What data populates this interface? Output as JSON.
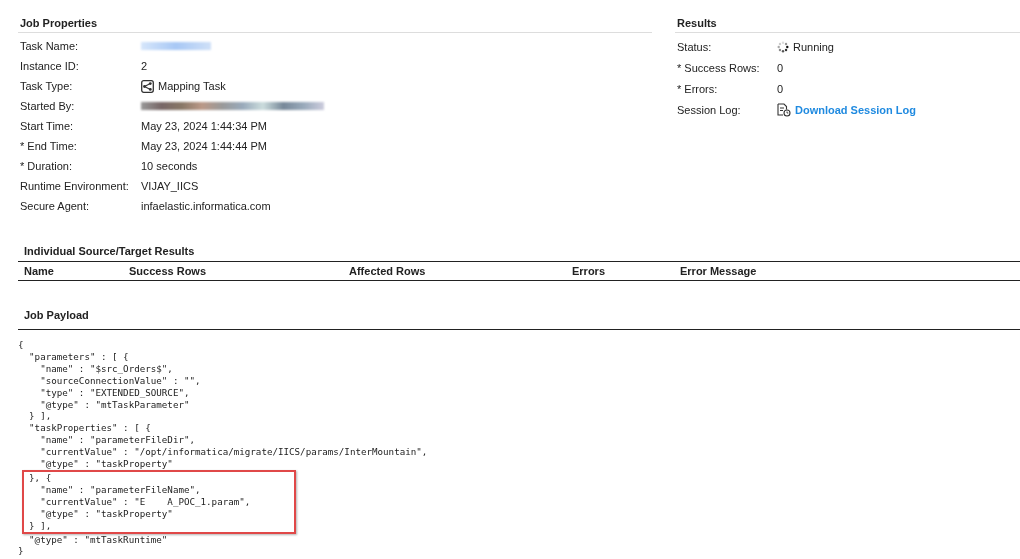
{
  "job_properties": {
    "title": "Job Properties",
    "fields": [
      {
        "label": "Task Name:",
        "kind": "redacted"
      },
      {
        "label": "Instance ID:",
        "kind": "text",
        "value": "2"
      },
      {
        "label": "Task Type:",
        "kind": "task_type",
        "value": "Mapping Task"
      },
      {
        "label": "Started By:",
        "kind": "redacted"
      },
      {
        "label": "Start Time:",
        "kind": "text",
        "value": "May 23, 2024 1:44:34 PM"
      },
      {
        "label": "* End Time:",
        "kind": "text",
        "value": "May 23, 2024 1:44:44 PM"
      },
      {
        "label": "* Duration:",
        "kind": "text",
        "value": "10 seconds"
      },
      {
        "label": "Runtime Environment:",
        "kind": "text",
        "value": "VIJAY_IICS"
      },
      {
        "label": "Secure Agent:",
        "kind": "text",
        "value": "infaelastic.informatica.com"
      }
    ]
  },
  "results": {
    "title": "Results",
    "fields": [
      {
        "label": "Status:",
        "kind": "status",
        "value": "Running"
      },
      {
        "label": "* Success Rows:",
        "kind": "text",
        "value": "0"
      },
      {
        "label": "* Errors:",
        "kind": "text",
        "value": "0"
      },
      {
        "label": "Session Log:",
        "kind": "link",
        "value": "Download Session Log"
      }
    ]
  },
  "source_target_results": {
    "title": "Individual Source/Target Results",
    "columns": [
      "Name",
      "Success Rows",
      "Affected Rows",
      "Errors",
      "Error Message"
    ]
  },
  "job_payload": {
    "title": "Job Payload",
    "lines": [
      {
        "text": "{",
        "highlighted": false
      },
      {
        "text": "  \"parameters\" : [ {",
        "highlighted": false
      },
      {
        "text": "    \"name\" : \"$src_Orders$\",",
        "highlighted": false
      },
      {
        "text": "    \"sourceConnectionValue\" : \"\",",
        "highlighted": false
      },
      {
        "text": "    \"type\" : \"EXTENDED_SOURCE\",",
        "highlighted": false
      },
      {
        "text": "    \"@type\" : \"mtTaskParameter\"",
        "highlighted": false
      },
      {
        "text": "  } ],",
        "highlighted": false
      },
      {
        "text": "  \"taskProperties\" : [ {",
        "highlighted": false
      },
      {
        "text": "    \"name\" : \"parameterFileDir\",",
        "highlighted": false
      },
      {
        "text": "    \"currentValue\" : \"/opt/informatica/migrate/IICS/params/InterMountain\",",
        "highlighted": false
      },
      {
        "text": "    \"@type\" : \"taskProperty\"",
        "highlighted": false
      },
      {
        "text": "  }, {",
        "highlighted": true
      },
      {
        "text": "    \"name\" : \"parameterFileName\",",
        "highlighted": true
      },
      {
        "text": "    \"currentValue\" : \"E    A_POC_1.param\",",
        "highlighted": true
      },
      {
        "text": "    \"@type\" : \"taskProperty\"",
        "highlighted": true
      },
      {
        "text": "  } ],",
        "highlighted": true
      },
      {
        "text": "  \"@type\" : \"mtTaskRuntime\"",
        "highlighted": false
      },
      {
        "text": "}",
        "highlighted": false
      }
    ]
  }
}
